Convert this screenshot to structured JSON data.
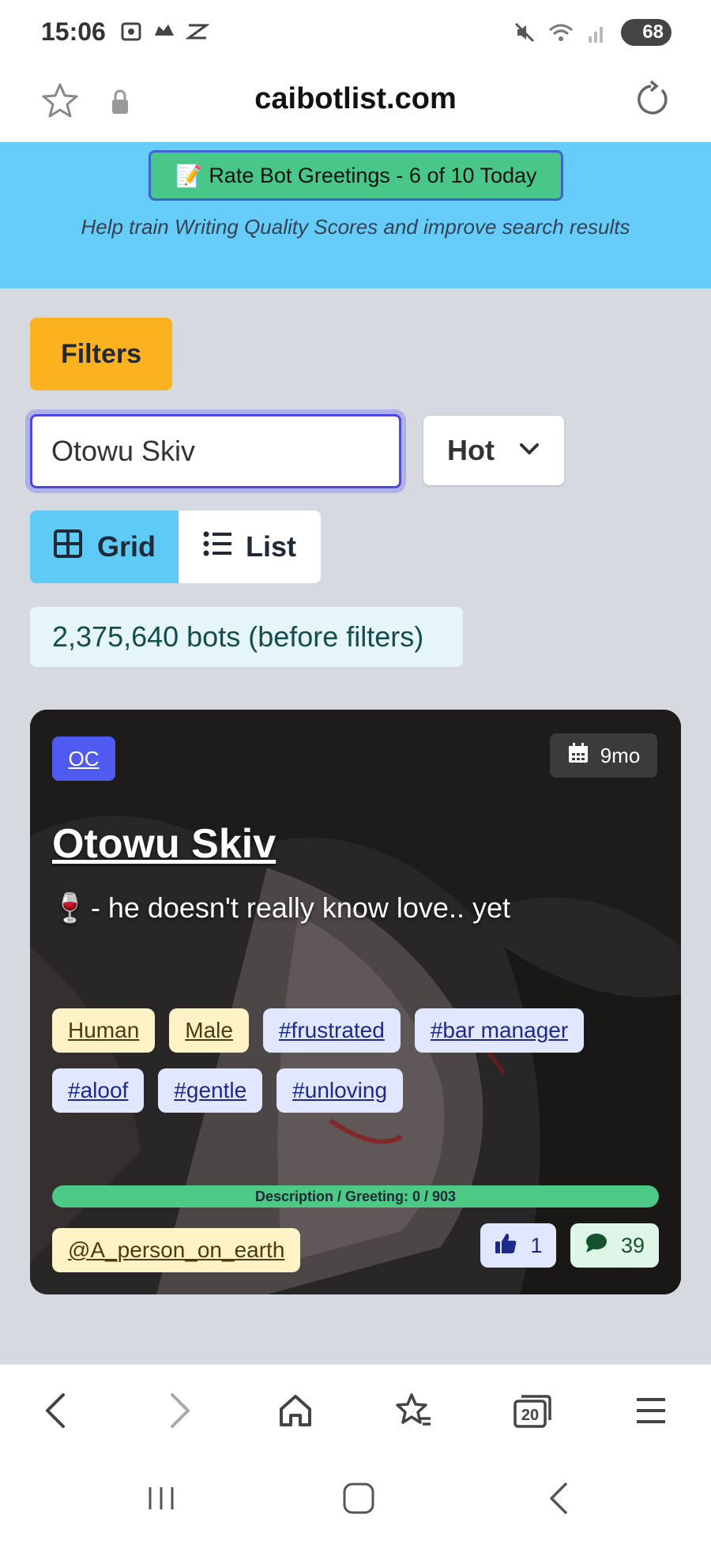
{
  "status_bar": {
    "time": "15:06",
    "battery": "68",
    "icons_left": [
      "screenshot-icon",
      "game-icon",
      "app-icon"
    ],
    "icons_right": [
      "mute-icon",
      "wifi-icon",
      "signal-icon",
      "battery-icon"
    ]
  },
  "browser": {
    "url": "caibotlist.com",
    "tab_count": "20"
  },
  "banner": {
    "emoji": "📝",
    "rate_button": "Rate Bot Greetings - 6 of 10 Today",
    "subtitle": "Help train Writing Quality Scores and improve search results"
  },
  "filters": {
    "filters_label": "Filters",
    "search_value": "Otowu Skiv",
    "sort_selected": "Hot",
    "view_grid_label": "Grid",
    "view_list_label": "List",
    "count_text": "2,375,640 bots (before filters)"
  },
  "card": {
    "badge": "OC",
    "age": "9mo",
    "title": "Otowu Skiv",
    "desc_emoji": "🍷",
    "description": "- he doesn't really know love.. yet",
    "tags": [
      {
        "label": "Human",
        "style": "yellow"
      },
      {
        "label": "Male",
        "style": "yellow"
      },
      {
        "label": "#frustrated",
        "style": "blue"
      },
      {
        "label": "#bar manager",
        "style": "blue"
      },
      {
        "label": "#aloof",
        "style": "blue"
      },
      {
        "label": "#gentle",
        "style": "blue"
      },
      {
        "label": "#unloving",
        "style": "blue"
      }
    ],
    "progress_text": "Description / Greeting: 0 / 903",
    "author": "@A_person_on_earth",
    "likes": "1",
    "comments": "39"
  },
  "colors": {
    "banner": "#66cdfa",
    "filters_button": "#fbb21e",
    "grid_active": "#5ecbf7",
    "progress": "#4bc985",
    "oc_badge": "#4f5bf0"
  }
}
